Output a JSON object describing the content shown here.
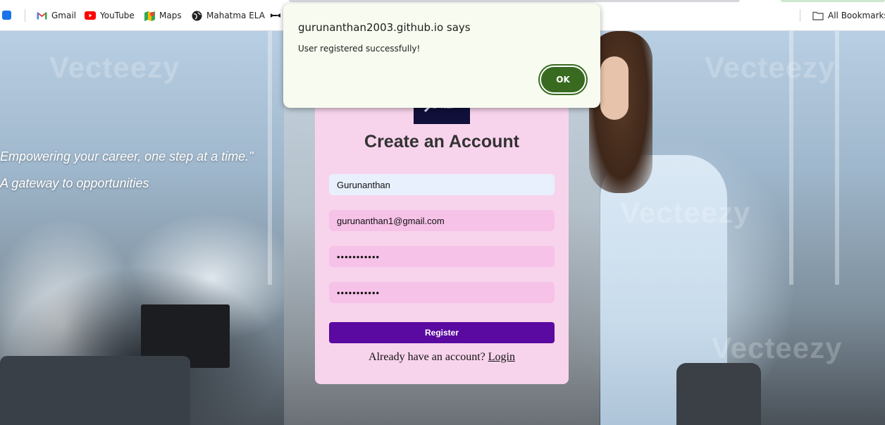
{
  "bookmarks_bar": {
    "items": [
      {
        "label": "Gmail",
        "icon": "gmail-icon"
      },
      {
        "label": "YouTube",
        "icon": "youtube-icon"
      },
      {
        "label": "Maps",
        "icon": "maps-icon"
      },
      {
        "label": "Mahatma ELA",
        "icon": "globe-icon"
      }
    ],
    "all_bookmarks": "All Bookmarks"
  },
  "hero": {
    "tagline_1": "Empowering your career, one step at a time.\"",
    "tagline_2": "A gateway to opportunities",
    "watermark": "Vecteezy"
  },
  "register_card": {
    "logo_text": "Finder",
    "title": "Create an Account",
    "name_value": "Gurunanthan",
    "email_value": "gurunanthan1@gmail.com",
    "password_value": "•••••••••••",
    "confirm_password_value": "•••••••••••",
    "register_label": "Register",
    "login_prompt": "Already have an account?",
    "login_link": "Login"
  },
  "alert_dialog": {
    "title": "gurunanthan2003.github.io says",
    "message": "User registered successfully!",
    "ok_label": "OK"
  },
  "colors": {
    "card_bg": "#f8d4ec",
    "register_button": "#5a0aa0",
    "ok_button": "#386a20",
    "dialog_bg": "#f7fbf0"
  }
}
